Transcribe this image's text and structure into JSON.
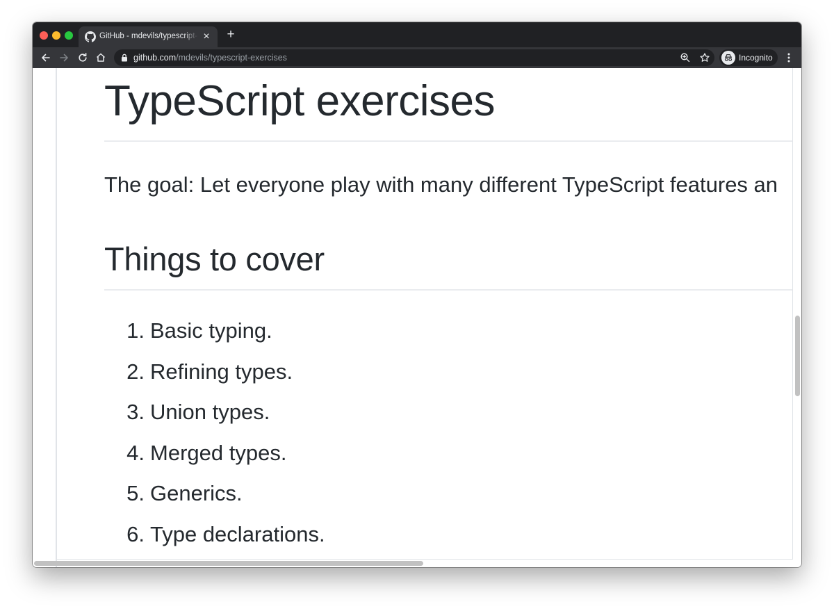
{
  "browser": {
    "tab": {
      "title": "GitHub - mdevils/typescript-exercises",
      "favicon": "github-icon"
    },
    "address_bar": {
      "host": "github.com",
      "path": "/mdevils/typescript-exercises"
    },
    "profile": {
      "label": "Incognito",
      "icon": "incognito-icon"
    },
    "colors": {
      "tabstrip": "#202124",
      "toolbar": "#35363a",
      "text": "#e8eaed",
      "muted": "#9aa0a6"
    }
  },
  "readme": {
    "title": "TypeScript exercises",
    "goal": "The goal: Let everyone play with many different TypeScript features an",
    "section_title": "Things to cover",
    "items": [
      {
        "number": "1.",
        "text": "Basic typing."
      },
      {
        "number": "2.",
        "text": "Refining types."
      },
      {
        "number": "3.",
        "text": "Union types."
      },
      {
        "number": "4.",
        "text": "Merged types."
      },
      {
        "number": "5.",
        "text": "Generics."
      },
      {
        "number": "6.",
        "text": "Type declarations."
      }
    ],
    "colors": {
      "text": "#24292e",
      "rule": "#eaecef"
    }
  }
}
